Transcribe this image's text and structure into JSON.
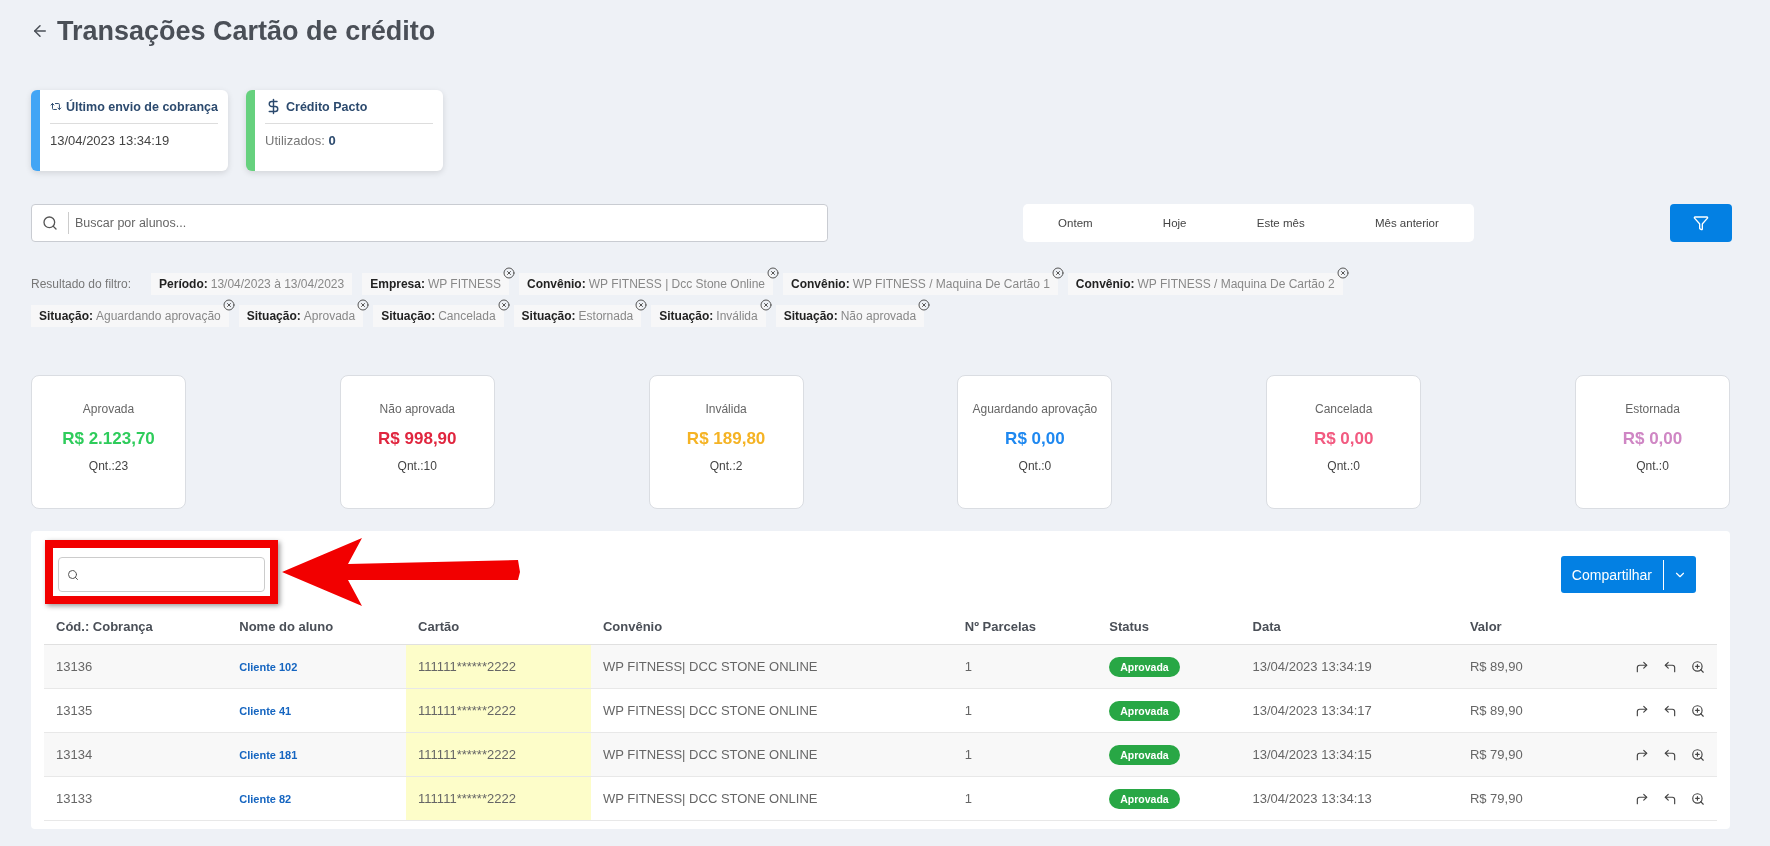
{
  "page_title": "Transações Cartão de crédito",
  "info_cards": [
    {
      "kind": "sync",
      "title": "Último envio de cobrança",
      "color": "#42a5f5",
      "value": "13/04/2023 13:34:19"
    },
    {
      "kind": "credit",
      "title": "Crédito Pacto",
      "color": "#66d17e",
      "label": "Utilizados:",
      "value": "0"
    }
  ],
  "search": {
    "placeholder": "Buscar por alunos..."
  },
  "date_filters": [
    "Ontem",
    "Hoje",
    "Este mês",
    "Mês anterior"
  ],
  "filter_result": {
    "label": "Resultado do filtro:",
    "chips": [
      {
        "name": "Período:",
        "value": "13/04/2023 à 13/04/2023",
        "removable": false
      },
      {
        "name": "Empresa:",
        "value": "WP FITNESS",
        "removable": true
      },
      {
        "name": "Convênio:",
        "value": "WP FITNESS | Dcc Stone Online",
        "removable": true
      },
      {
        "name": "Convênio:",
        "value": "WP FITNESS / Maquina De Cartão 1",
        "removable": true
      },
      {
        "name": "Convênio:",
        "value": "WP FITNESS / Maquina De Cartão 2",
        "removable": true
      },
      {
        "name": "Situação:",
        "value": "Aguardando aprovação",
        "removable": true
      },
      {
        "name": "Situação:",
        "value": "Aprovada",
        "removable": true
      },
      {
        "name": "Situação:",
        "value": "Cancelada",
        "removable": true
      },
      {
        "name": "Situação:",
        "value": "Estornada",
        "removable": true
      },
      {
        "name": "Situação:",
        "value": "Inválida",
        "removable": true
      },
      {
        "name": "Situação:",
        "value": "Não aprovada",
        "removable": true
      }
    ]
  },
  "summary": [
    {
      "label": "Aprovada",
      "amount": "R$ 2.123,70",
      "count": "Qnt.:23",
      "color": "#2ecc5b"
    },
    {
      "label": "Não aprovada",
      "amount": "R$ 998,90",
      "count": "Qnt.:10",
      "color": "#e0263f"
    },
    {
      "label": "Inválida",
      "amount": "R$ 189,80",
      "count": "Qnt.:2",
      "color": "#f5b324"
    },
    {
      "label": "Aguardando aprovação",
      "amount": "R$ 0,00",
      "count": "Qnt.:0",
      "color": "#1e88f0"
    },
    {
      "label": "Cancelada",
      "amount": "R$ 0,00",
      "count": "Qnt.:0",
      "color": "#f25a80"
    },
    {
      "label": "Estornada",
      "amount": "R$ 0,00",
      "count": "Qnt.:0",
      "color": "#cf86c4"
    }
  ],
  "table": {
    "share_button": "Compartilhar",
    "columns": [
      "Cód.: Cobrança",
      "Nome do aluno",
      "Cartão",
      "Convênio",
      "Nº Parcelas",
      "Status",
      "Data",
      "Valor"
    ],
    "rows": [
      {
        "code": "13136",
        "name": "Cliente 102",
        "card": "111111******2222",
        "agreement": "WP FITNESS| DCC STONE ONLINE",
        "installments": "1",
        "status": "Aprovada",
        "date": "13/04/2023 13:34:19",
        "value": "R$ 89,90"
      },
      {
        "code": "13135",
        "name": "Cliente 41",
        "card": "111111******2222",
        "agreement": "WP FITNESS| DCC STONE ONLINE",
        "installments": "1",
        "status": "Aprovada",
        "date": "13/04/2023 13:34:17",
        "value": "R$ 89,90"
      },
      {
        "code": "13134",
        "name": "Cliente 181",
        "card": "111111******2222",
        "agreement": "WP FITNESS| DCC STONE ONLINE",
        "installments": "1",
        "status": "Aprovada",
        "date": "13/04/2023 13:34:15",
        "value": "R$ 79,90"
      },
      {
        "code": "13133",
        "name": "Cliente 82",
        "card": "111111******2222",
        "agreement": "WP FITNESS| DCC STONE ONLINE",
        "installments": "1",
        "status": "Aprovada",
        "date": "13/04/2023 13:34:13",
        "value": "R$ 79,90"
      }
    ]
  }
}
